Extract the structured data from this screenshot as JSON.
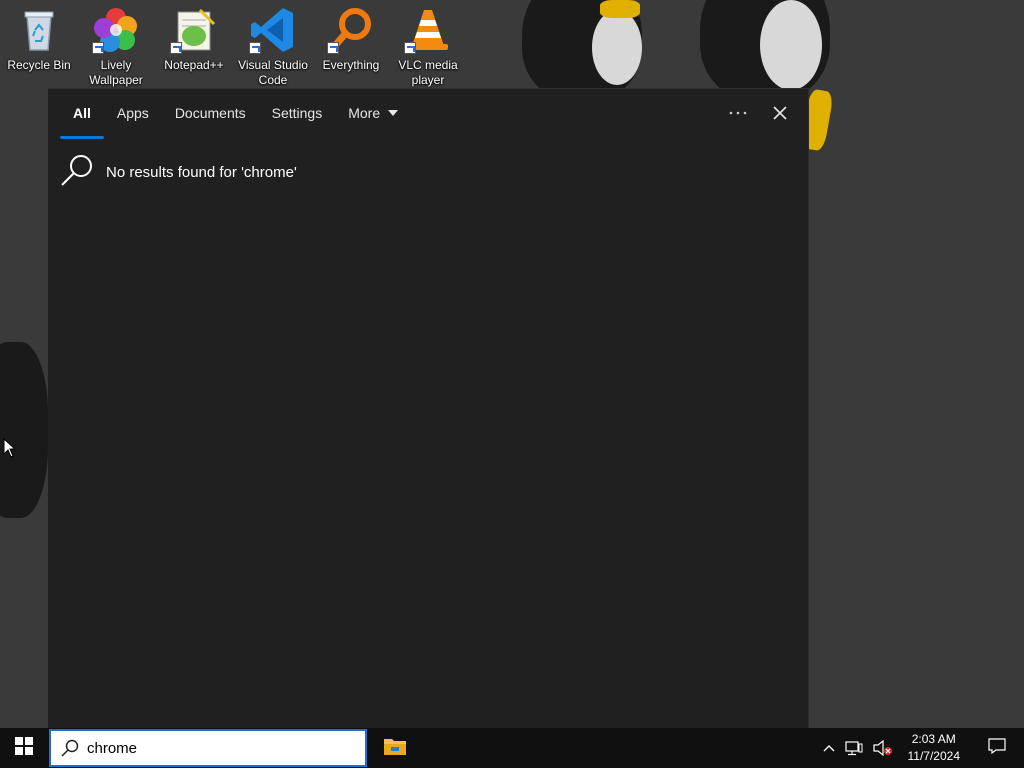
{
  "desktop": {
    "icons": [
      {
        "label": "Recycle Bin",
        "icon": "recycle-bin-icon"
      },
      {
        "label": "Lively Wallpaper",
        "icon": "lively-wallpaper-icon"
      },
      {
        "label": "Notepad++",
        "icon": "notepadpp-icon"
      },
      {
        "label": "Visual Studio Code",
        "icon": "vscode-icon"
      },
      {
        "label": "Everything",
        "icon": "everything-icon"
      },
      {
        "label": "VLC media player",
        "icon": "vlc-icon"
      }
    ]
  },
  "search_panel": {
    "tabs": [
      {
        "label": "All",
        "active": true
      },
      {
        "label": "Apps",
        "active": false
      },
      {
        "label": "Documents",
        "active": false
      },
      {
        "label": "Settings",
        "active": false
      },
      {
        "label": "More",
        "active": false
      }
    ],
    "more_icon": "ellipsis-icon",
    "close_icon": "close-icon",
    "no_results_text": "No results found for 'chrome'"
  },
  "taskbar": {
    "search_value": "chrome",
    "pinned_app": "file-explorer-icon",
    "clock_time": "2:03 AM",
    "clock_date": "11/7/2024"
  },
  "colors": {
    "accent": "#0a78d7",
    "panel_bg": "#202020",
    "taskbar_bg": "#101010"
  }
}
